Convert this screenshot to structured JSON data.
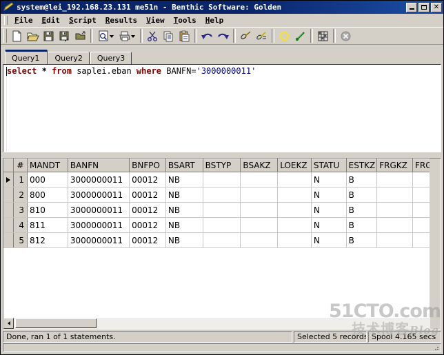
{
  "window": {
    "title": "system@lei_192.168.23.131 me51n - Benthic Software: Golden",
    "icon": "pencil-icon",
    "minimize_label": "_",
    "maximize_label": "□",
    "close_label": "✕"
  },
  "menu": {
    "items": [
      {
        "label": "File",
        "accel": "F"
      },
      {
        "label": "Edit",
        "accel": "E"
      },
      {
        "label": "Script",
        "accel": "S"
      },
      {
        "label": "Results",
        "accel": "R"
      },
      {
        "label": "View",
        "accel": "V"
      },
      {
        "label": "Tools",
        "accel": "T"
      },
      {
        "label": "Help",
        "accel": "H"
      }
    ]
  },
  "toolbar": {
    "buttons": [
      {
        "name": "new-icon",
        "tooltip": "New"
      },
      {
        "name": "open-folder-icon",
        "tooltip": "Open"
      },
      {
        "name": "save-icon",
        "tooltip": "Save"
      },
      {
        "name": "save-all-icon",
        "tooltip": "Save All"
      },
      {
        "name": "open-script-icon",
        "tooltip": "Open Script"
      },
      {
        "name": "print-preview-icon",
        "tooltip": "Print Preview"
      },
      {
        "name": "print-icon",
        "tooltip": "Print"
      },
      {
        "name": "cut-icon",
        "tooltip": "Cut"
      },
      {
        "name": "copy-icon",
        "tooltip": "Copy"
      },
      {
        "name": "paste-icon",
        "tooltip": "Paste"
      },
      {
        "name": "undo-icon",
        "tooltip": "Undo"
      },
      {
        "name": "redo-icon",
        "tooltip": "Redo"
      },
      {
        "name": "execute-icon",
        "tooltip": "Execute"
      },
      {
        "name": "execute-script-icon",
        "tooltip": "Execute Script"
      },
      {
        "name": "stop-ring-icon",
        "tooltip": "Stop"
      },
      {
        "name": "commit-icon",
        "tooltip": "Commit"
      },
      {
        "name": "grid-icon",
        "tooltip": "Grid"
      },
      {
        "name": "cancel-icon",
        "tooltip": "Cancel"
      }
    ]
  },
  "tabs": {
    "items": [
      {
        "label": "Query1",
        "active": true
      },
      {
        "label": "Query2",
        "active": false
      },
      {
        "label": "Query3",
        "active": false
      }
    ]
  },
  "editor": {
    "sql_tokens": [
      {
        "text": "select",
        "type": "kw"
      },
      {
        "text": " ",
        "type": "id"
      },
      {
        "text": "*",
        "type": "op"
      },
      {
        "text": " ",
        "type": "id"
      },
      {
        "text": "from",
        "type": "kw"
      },
      {
        "text": " saplei.eban ",
        "type": "id"
      },
      {
        "text": "where",
        "type": "kw"
      },
      {
        "text": " BANFN=",
        "type": "id"
      },
      {
        "text": "'3000000011'",
        "type": "str"
      }
    ],
    "sql_plain": "select * from saplei.eban where BANFN='3000000011'"
  },
  "grid": {
    "columns": [
      "#",
      "MANDT",
      "BANFN",
      "BNFPO",
      "BSART",
      "BSTYP",
      "BSAKZ",
      "LOEKZ",
      "STATU",
      "ESTKZ",
      "FRGKZ",
      "FRGZU"
    ],
    "rows": [
      {
        "num": "1",
        "selected": true,
        "cells": [
          "000",
          "3000000011",
          "00012",
          "NB",
          "",
          "",
          "",
          "N",
          "B",
          "",
          ""
        ]
      },
      {
        "num": "2",
        "selected": false,
        "cells": [
          "800",
          "3000000011",
          "00012",
          "NB",
          "",
          "",
          "",
          "N",
          "B",
          "",
          ""
        ]
      },
      {
        "num": "3",
        "selected": false,
        "cells": [
          "810",
          "3000000011",
          "00012",
          "NB",
          "",
          "",
          "",
          "N",
          "B",
          "",
          ""
        ]
      },
      {
        "num": "4",
        "selected": false,
        "cells": [
          "811",
          "3000000011",
          "00012",
          "NB",
          "",
          "",
          "",
          "N",
          "B",
          "",
          ""
        ]
      },
      {
        "num": "5",
        "selected": false,
        "cells": [
          "812",
          "3000000011",
          "00012",
          "NB",
          "",
          "",
          "",
          "N",
          "B",
          "",
          ""
        ]
      }
    ]
  },
  "status": {
    "message": "Done, ran 1 of 1 statements.",
    "selected": "Selected 5 records",
    "timing": "Spool 4.165 secs"
  },
  "watermark": {
    "line1": "51CTO.com",
    "line2": "技术博客",
    "blog": "Blog"
  },
  "colors": {
    "titlebar": "#0a246a",
    "face": "#d4d0c8",
    "keyword": "#800000",
    "string": "#00007f",
    "grid_line": "#c8c8c8"
  }
}
